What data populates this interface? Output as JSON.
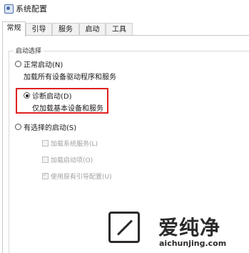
{
  "window": {
    "title": "系统配置"
  },
  "tabs": [
    {
      "label": "常规",
      "active": true
    },
    {
      "label": "引导",
      "active": false
    },
    {
      "label": "服务",
      "active": false
    },
    {
      "label": "启动",
      "active": false
    },
    {
      "label": "工具",
      "active": false
    }
  ],
  "startup": {
    "group_label": "启动选择",
    "options": [
      {
        "label": "正常启动(N)",
        "description": "加载所有设备驱动程序和服务",
        "selected": false
      },
      {
        "label": "诊断启动(D)",
        "description": "仅加载基本设备和服务",
        "selected": true
      },
      {
        "label": "有选择的启动(S)",
        "description": "",
        "selected": false
      }
    ],
    "selective_items": [
      {
        "label": "加载系统服务(L)",
        "checked": false
      },
      {
        "label": "加载启动项(O)",
        "checked": false
      },
      {
        "label": "使用原有引导配置(U)",
        "checked": true
      }
    ]
  },
  "annotation": {
    "highlight_color": "#e02020"
  },
  "watermark": {
    "text": "爱纯净",
    "url": "aichunjing.com"
  }
}
